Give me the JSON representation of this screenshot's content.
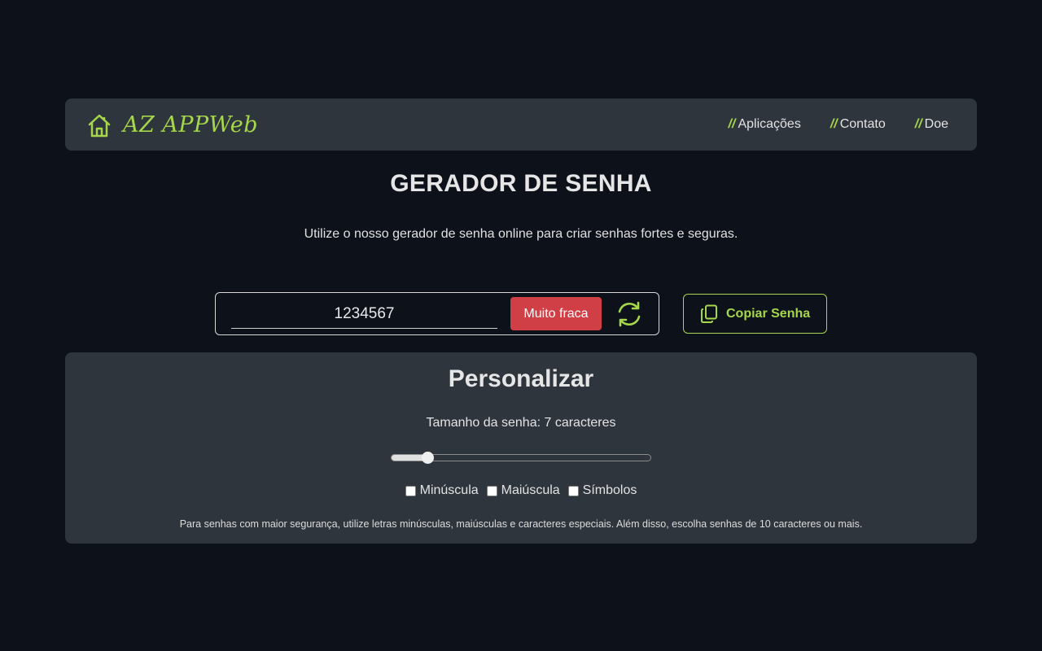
{
  "brand": {
    "name": "AZ APPWeb"
  },
  "nav": {
    "slash": "//",
    "links": [
      {
        "label": "Aplicações"
      },
      {
        "label": "Contato"
      },
      {
        "label": "Doe"
      }
    ]
  },
  "header": {
    "title": "GERADOR DE SENHA",
    "subtitle": "Utilize o nosso gerador de senha online para criar senhas fortes e seguras."
  },
  "generator": {
    "password": "1234567",
    "strength_label": "Muito fraca",
    "strength_color": "#cf3f45",
    "copy_label": "Copiar Senha"
  },
  "customize": {
    "title": "Personalizar",
    "size_label": "Tamanho da senha: 7 caracteres",
    "slider_value": 0.14,
    "options": [
      {
        "label": "Minúscula",
        "checked": false
      },
      {
        "label": "Maiúscula",
        "checked": false
      },
      {
        "label": "Símbolos",
        "checked": false
      }
    ],
    "hint": "Para senhas com maior segurança, utilize letras minúsculas, maiúsculas e caracteres especiais. Além disso, escolha senhas de 10 caracteres ou mais."
  },
  "colors": {
    "accent": "#a6d64a",
    "background": "#0d111a",
    "surface": "#2f353d"
  }
}
